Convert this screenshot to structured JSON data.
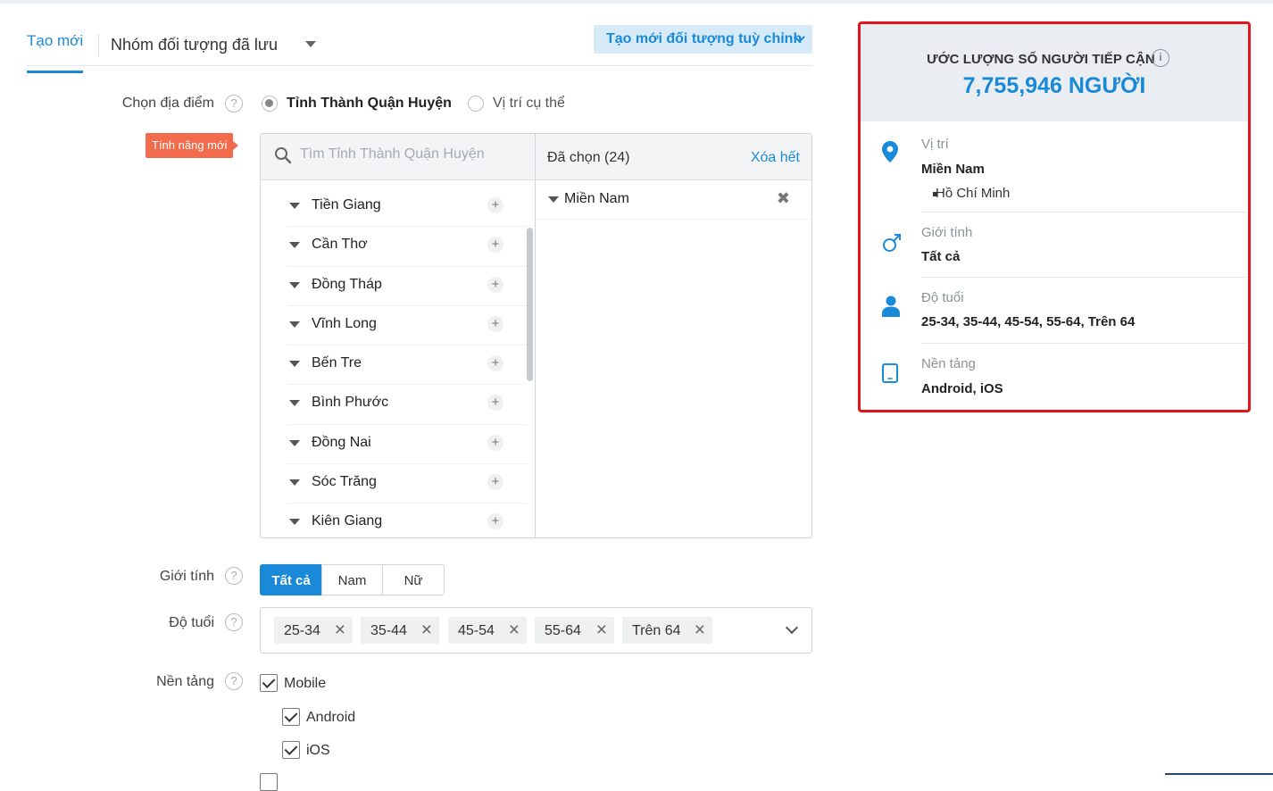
{
  "tabs": {
    "new": "Tạo mới",
    "saved": "Nhóm đối tượng đã lưu",
    "custom_button": "Tạo mới đối tượng tuỳ chỉnh"
  },
  "location": {
    "label": "Chọn địa điểm",
    "radio_province": "Tỉnh Thành Quận Huyện",
    "radio_specific": "Vị trí cụ thể",
    "new_feature_badge": "Tính năng mới",
    "search_placeholder": "Tìm Tỉnh Thành Quận Huyện",
    "provinces": [
      "Tiền Giang",
      "Cần Thơ",
      "Đồng Tháp",
      "Vĩnh Long",
      "Bến Tre",
      "Bình Phước",
      "Đồng Nai",
      "Sóc Trăng",
      "Kiên Giang"
    ],
    "selected_header": "Đã chọn (24)",
    "clear_all": "Xóa hết",
    "selected_items": [
      "Miền Nam"
    ]
  },
  "gender": {
    "label": "Giới tính",
    "options": [
      "Tất cả",
      "Nam",
      "Nữ"
    ],
    "selected": "Tất cả"
  },
  "age": {
    "label": "Độ tuổi",
    "chips": [
      "25-34",
      "35-44",
      "45-54",
      "55-64",
      "Trên 64"
    ]
  },
  "platform": {
    "label": "Nền tảng",
    "mobile": "Mobile",
    "android": "Android",
    "ios": "iOS"
  },
  "reach": {
    "title": "ƯỚC LƯỢNG SỐ NGƯỜI TIẾP CẬN",
    "count": "7,755,946 NGƯỜI",
    "location_label": "Vị trí",
    "location_value": "Miền Nam",
    "location_sub": "Hồ Chí Minh",
    "gender_label": "Giới tính",
    "gender_value": "Tất cả",
    "age_label": "Độ tuổi",
    "age_value": "25-34, 35-44, 45-54, 55-64, Trên 64",
    "platform_label": "Nền tảng",
    "platform_value": "Android, iOS"
  },
  "colors": {
    "accent": "#1a8ad8",
    "highlight_border": "#e5141c",
    "badge": "#f26b4d"
  }
}
